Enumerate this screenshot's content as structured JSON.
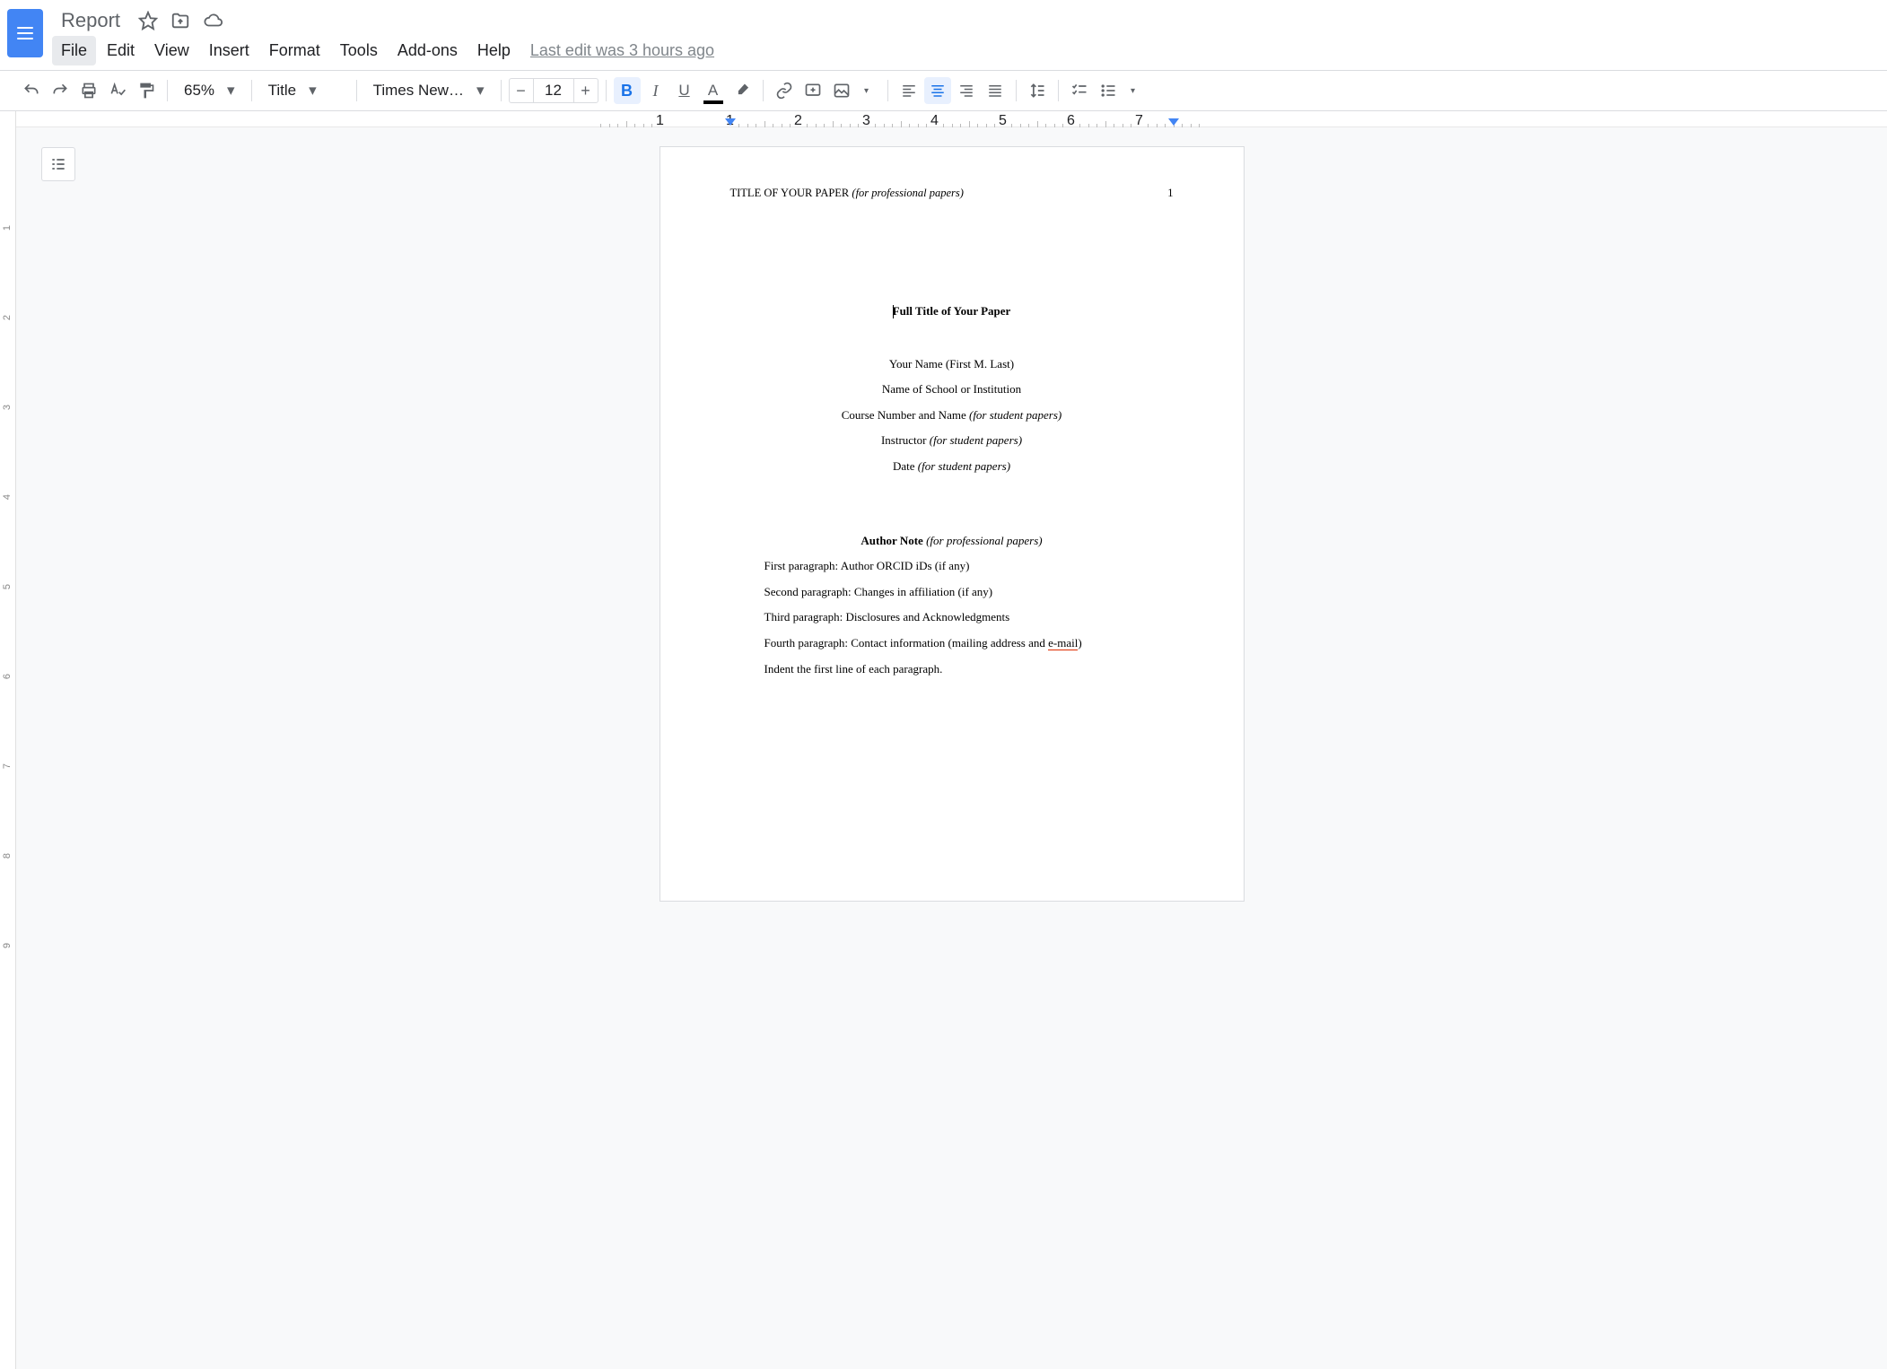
{
  "header": {
    "title": "Report",
    "last_edit": "Last edit was 3 hours ago"
  },
  "menu": [
    "File",
    "Edit",
    "View",
    "Insert",
    "Format",
    "Tools",
    "Add-ons",
    "Help"
  ],
  "toolbar": {
    "zoom": "65%",
    "style": "Title",
    "font": "Times New…",
    "font_size": "12"
  },
  "ruler": {
    "h_labels": [
      "1",
      "1",
      "2",
      "3",
      "4",
      "5",
      "6",
      "7"
    ],
    "v_labels": [
      "1",
      "2",
      "3",
      "4",
      "5",
      "6",
      "7",
      "8",
      "9"
    ]
  },
  "doc": {
    "running_head": "TITLE OF YOUR PAPER",
    "running_head_note": "(for professional papers)",
    "page_num": "1",
    "title": "Full Title of Your Paper",
    "author": "Your Name (First M. Last)",
    "school": "Name of School or Institution",
    "course": "Course Number and Name",
    "course_note": "(for student papers)",
    "instructor": "Instructor",
    "instructor_note": "(for student papers)",
    "date": "Date",
    "date_note": "(for student papers)",
    "author_note": "Author Note",
    "author_note_note": "(for professional papers)",
    "p1": "First paragraph: Author ORCID iDs (if any)",
    "p2": "Second paragraph: Changes in affiliation (if any)",
    "p3": "Third paragraph: Disclosures and Acknowledgments",
    "p4a": "Fourth paragraph: Contact information (mailing address and ",
    "p4_spell": "e-mail",
    "p4b": ")",
    "p5": "Indent the first line of each paragraph."
  }
}
